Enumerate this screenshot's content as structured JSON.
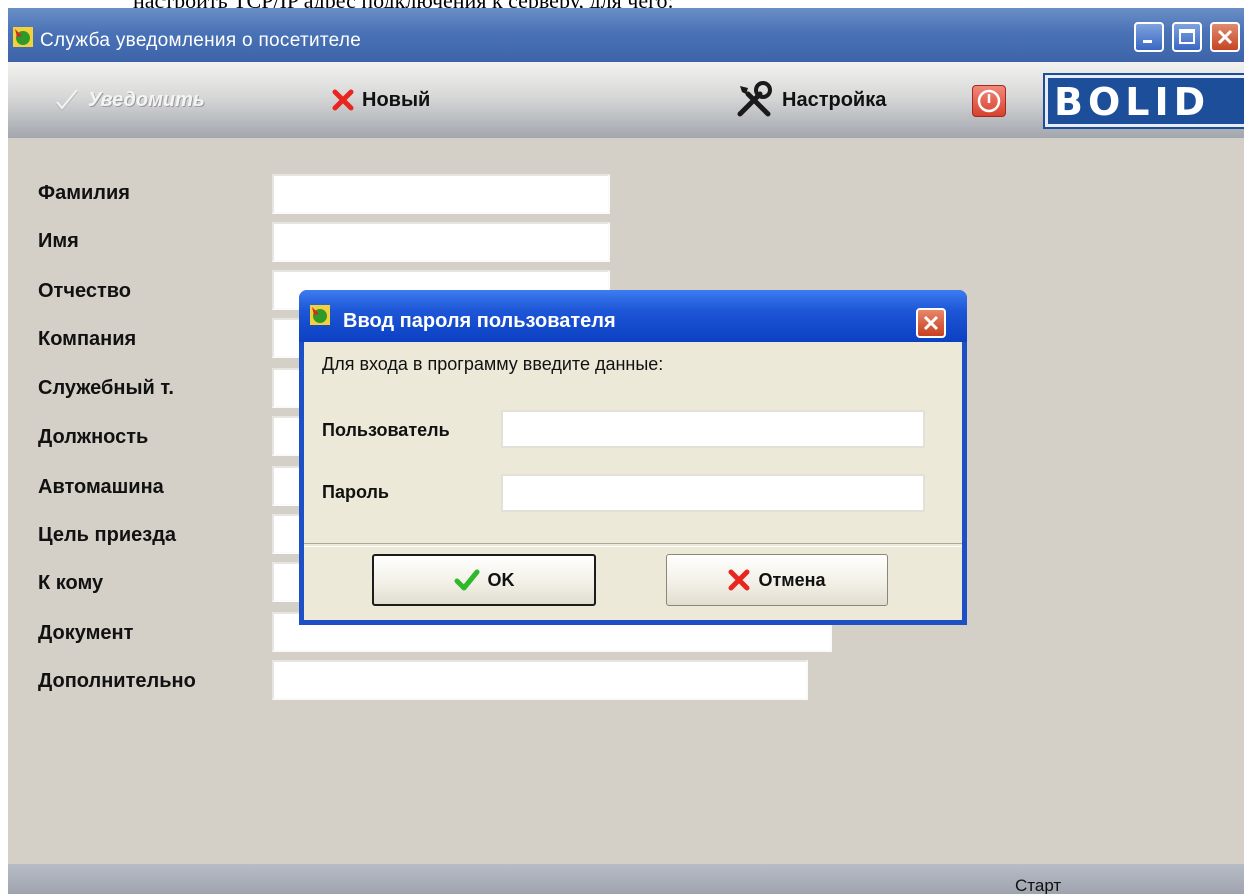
{
  "document": {
    "partial_text": "настроить TCP/IP адрес подключения к серверу, для чего:"
  },
  "window": {
    "title": "Служба уведомления о посетителе"
  },
  "toolbar": {
    "notify_label": "Уведомить",
    "new_label": "Новый",
    "settings_label": "Настройка",
    "logo_text": "BOLID"
  },
  "form": {
    "fields": [
      {
        "label": "Фамилия",
        "value": ""
      },
      {
        "label": "Имя",
        "value": ""
      },
      {
        "label": "Отчество",
        "value": ""
      },
      {
        "label": "Компания",
        "value": ""
      },
      {
        "label": "Служебный т.",
        "value": ""
      },
      {
        "label": "Должность",
        "value": ""
      },
      {
        "label": "Автомашина",
        "value": ""
      },
      {
        "label": "Цель приезда",
        "value": ""
      },
      {
        "label": "К кому",
        "value": ""
      },
      {
        "label": "Документ",
        "value": ""
      },
      {
        "label": "Дополнительно",
        "value": ""
      }
    ]
  },
  "status": {
    "start_label": "Старт"
  },
  "dialog": {
    "title": "Ввод пароля пользователя",
    "prompt": "Для входа в программу введите данные:",
    "user_label": "Пользователь",
    "password_label": "Пароль",
    "user_value": "",
    "password_value": "",
    "ok_label": "OK",
    "cancel_label": "Отмена"
  },
  "icons": {
    "app": "app-leaf-icon",
    "notify": "checkmark-icon",
    "new": "red-x-icon",
    "settings": "tools-icon",
    "power": "power-icon",
    "ok": "green-check-icon",
    "cancel": "red-x-icon"
  },
  "colors": {
    "title_bar": "#4a72b6",
    "dialog_title": "#1d56d6",
    "window_bg": "#d4d0c8",
    "dialog_bg": "#ece9d8",
    "logo_blue": "#1d4e9a",
    "accent_red": "#e8261f",
    "accent_green": "#2fb82a"
  }
}
